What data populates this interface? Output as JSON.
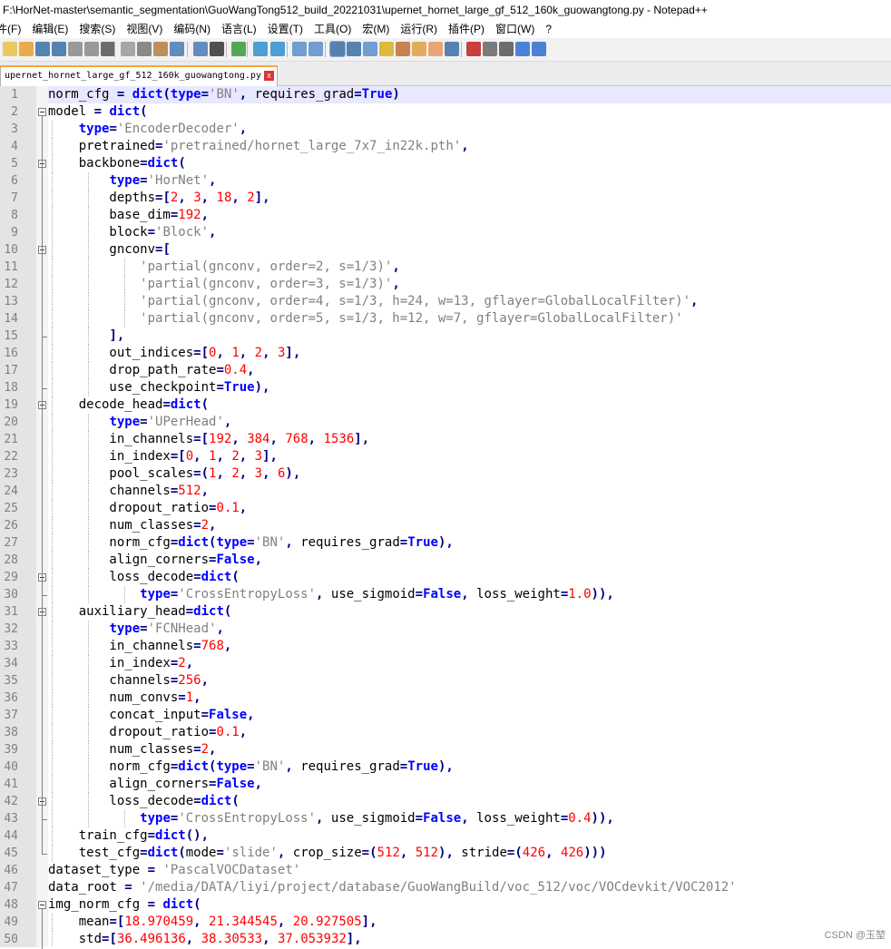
{
  "window": {
    "title": "F:\\HorNet-master\\semantic_segmentation\\GuoWangTong512_build_20221031\\upernet_hornet_large_gf_512_160k_guowangtong.py - Notepad++"
  },
  "menu": [
    "件(F)",
    "编辑(E)",
    "搜索(S)",
    "视图(V)",
    "编码(N)",
    "语言(L)",
    "设置(T)",
    "工具(O)",
    "宏(M)",
    "运行(R)",
    "插件(P)",
    "窗口(W)",
    "?"
  ],
  "tab": {
    "label": "upernet_hornet_large_gf_512_160k_guowangtong.py",
    "close": "x"
  },
  "watermark": "CSDN @玉堃",
  "colors": {
    "keyword": "#0000ff",
    "string": "#808080",
    "number": "#ff0000",
    "operator": "#000080",
    "current_line": "#e8e8ff",
    "tab_accent": "#f7a830"
  },
  "toolbar_icons": [
    "new-file-icon",
    "open-file-icon",
    "save-icon",
    "save-all-icon",
    "close-icon",
    "close-all-icon",
    "print-icon",
    "cut-icon",
    "copy-icon",
    "paste-icon",
    "undo-icon",
    "redo-icon",
    "find-icon",
    "replace-icon",
    "zoom-in-icon",
    "zoom-out-icon",
    "sync-vertical-icon",
    "sync-horizontal-icon",
    "word-wrap-icon",
    "show-all-characters-icon",
    "indent-guide-icon",
    "user-defined-language-icon",
    "document-map-icon",
    "function-list-icon",
    "folder-as-workspace-icon",
    "monitoring-icon",
    "record-macro-icon",
    "stop-macro-icon",
    "play-macro-icon",
    "run-macro-multiple-icon",
    "save-macro-icon"
  ],
  "code": [
    {
      "n": "1",
      "t": "norm_cfg = dict(type='BN', requires_grad=True)"
    },
    {
      "n": "2",
      "t": "model = dict("
    },
    {
      "n": "3",
      "t": "    type='EncoderDecoder',"
    },
    {
      "n": "4",
      "t": "    pretrained='pretrained/hornet_large_7x7_in22k.pth',"
    },
    {
      "n": "5",
      "t": "    backbone=dict("
    },
    {
      "n": "6",
      "t": "        type='HorNet',"
    },
    {
      "n": "7",
      "t": "        depths=[2, 3, 18, 2],"
    },
    {
      "n": "8",
      "t": "        base_dim=192,"
    },
    {
      "n": "9",
      "t": "        block='Block',"
    },
    {
      "n": "10",
      "t": "        gnconv=["
    },
    {
      "n": "11",
      "t": "            'partial(gnconv, order=2, s=1/3)',"
    },
    {
      "n": "12",
      "t": "            'partial(gnconv, order=3, s=1/3)',"
    },
    {
      "n": "13",
      "t": "            'partial(gnconv, order=4, s=1/3, h=24, w=13, gflayer=GlobalLocalFilter)',"
    },
    {
      "n": "14",
      "t": "            'partial(gnconv, order=5, s=1/3, h=12, w=7, gflayer=GlobalLocalFilter)'"
    },
    {
      "n": "15",
      "t": "        ],"
    },
    {
      "n": "16",
      "t": "        out_indices=[0, 1, 2, 3],"
    },
    {
      "n": "17",
      "t": "        drop_path_rate=0.4,"
    },
    {
      "n": "18",
      "t": "        use_checkpoint=True),"
    },
    {
      "n": "19",
      "t": "    decode_head=dict("
    },
    {
      "n": "20",
      "t": "        type='UPerHead',"
    },
    {
      "n": "21",
      "t": "        in_channels=[192, 384, 768, 1536],"
    },
    {
      "n": "22",
      "t": "        in_index=[0, 1, 2, 3],"
    },
    {
      "n": "23",
      "t": "        pool_scales=(1, 2, 3, 6),"
    },
    {
      "n": "24",
      "t": "        channels=512,"
    },
    {
      "n": "25",
      "t": "        dropout_ratio=0.1,"
    },
    {
      "n": "26",
      "t": "        num_classes=2,"
    },
    {
      "n": "27",
      "t": "        norm_cfg=dict(type='BN', requires_grad=True),"
    },
    {
      "n": "28",
      "t": "        align_corners=False,"
    },
    {
      "n": "29",
      "t": "        loss_decode=dict("
    },
    {
      "n": "30",
      "t": "            type='CrossEntropyLoss', use_sigmoid=False, loss_weight=1.0)),"
    },
    {
      "n": "31",
      "t": "    auxiliary_head=dict("
    },
    {
      "n": "32",
      "t": "        type='FCNHead',"
    },
    {
      "n": "33",
      "t": "        in_channels=768,"
    },
    {
      "n": "34",
      "t": "        in_index=2,"
    },
    {
      "n": "35",
      "t": "        channels=256,"
    },
    {
      "n": "36",
      "t": "        num_convs=1,"
    },
    {
      "n": "37",
      "t": "        concat_input=False,"
    },
    {
      "n": "38",
      "t": "        dropout_ratio=0.1,"
    },
    {
      "n": "39",
      "t": "        num_classes=2,"
    },
    {
      "n": "40",
      "t": "        norm_cfg=dict(type='BN', requires_grad=True),"
    },
    {
      "n": "41",
      "t": "        align_corners=False,"
    },
    {
      "n": "42",
      "t": "        loss_decode=dict("
    },
    {
      "n": "43",
      "t": "            type='CrossEntropyLoss', use_sigmoid=False, loss_weight=0.4)),"
    },
    {
      "n": "44",
      "t": "    train_cfg=dict(),"
    },
    {
      "n": "45",
      "t": "    test_cfg=dict(mode='slide', crop_size=(512, 512), stride=(426, 426)))"
    },
    {
      "n": "46",
      "t": "dataset_type = 'PascalVOCDataset'"
    },
    {
      "n": "47",
      "t": "data_root = '/media/DATA/liyi/project/database/GuoWangBuild/voc_512/voc/VOCdevkit/VOC2012'"
    },
    {
      "n": "48",
      "t": "img_norm_cfg = dict("
    },
    {
      "n": "49",
      "t": "    mean=[18.970459, 21.344545, 20.927505],"
    },
    {
      "n": "50",
      "t": "    std=[36.496136, 38.30533, 37.053932],"
    }
  ]
}
